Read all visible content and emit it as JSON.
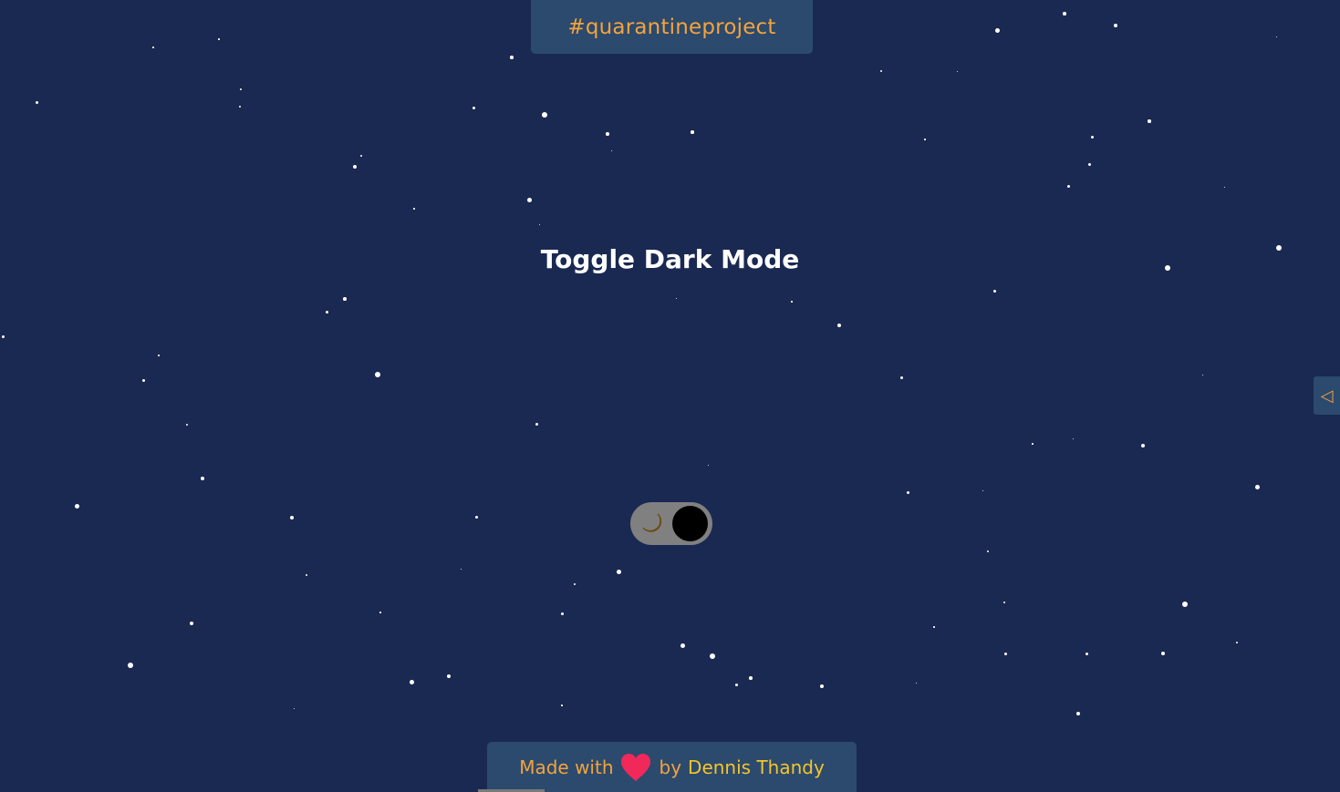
{
  "header": {
    "tag": "#quarantineproject"
  },
  "main": {
    "title": "Toggle Dark Mode",
    "toggle": {
      "icon": "moon-icon",
      "state": "dark"
    }
  },
  "side_tab": {
    "icon": "triangle-left-icon",
    "glyph": "◁"
  },
  "footer": {
    "prefix": "Made with",
    "heart_icon": "heart-icon",
    "by": "by",
    "author": "Dennis Thandy"
  },
  "colors": {
    "background": "#1a2952",
    "panel": "#2b4a6e",
    "accent_orange": "#f5a33b",
    "accent_yellow": "#f6c42a",
    "heart": "#f0295a",
    "toggle_track": "#808080",
    "toggle_knob": "#000000"
  }
}
